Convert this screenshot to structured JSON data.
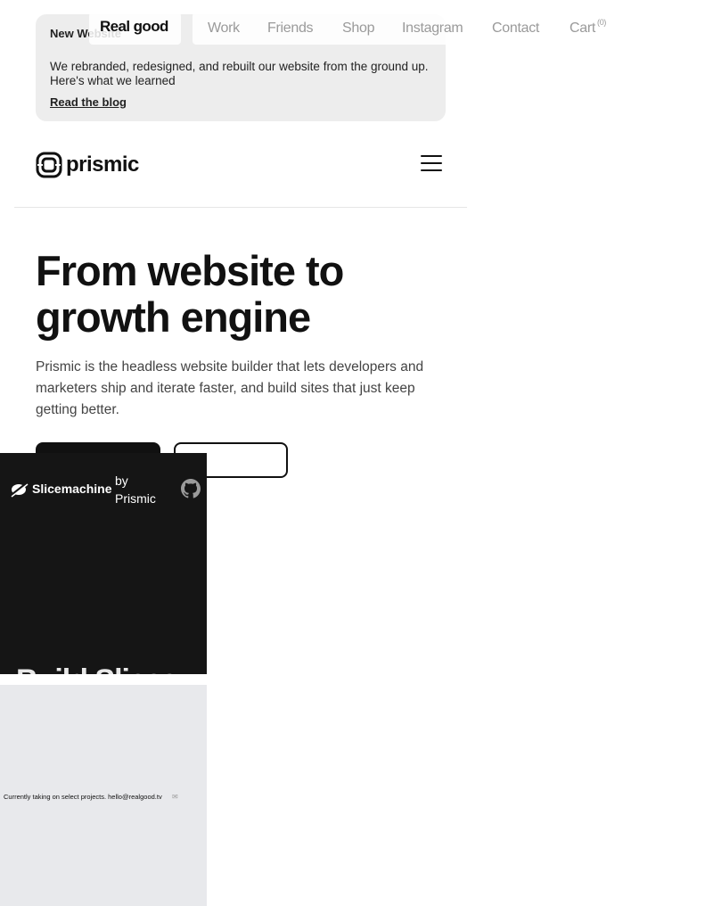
{
  "banner": {
    "title": "New Website",
    "text": "We rebranded, redesigned, and rebuilt our website from the ground up. Here's what we learned",
    "link": "Read the blog"
  },
  "prismic_nav": {
    "logo_text": "prismic"
  },
  "hero": {
    "title": "From website to growth engine",
    "subtitle": "Prismic is the headless website builder that lets developers and marketers ship and iterate faster, and build sites that just keep getting better."
  },
  "realgood_nav": {
    "brand": "Real good",
    "items": [
      "Work",
      "Friends",
      "Shop",
      "Instagram",
      "Contact"
    ],
    "cart_label": "Cart",
    "cart_count": "(0)"
  },
  "slicemachine": {
    "name": "Slicemachine",
    "by": "by Prismic",
    "headline_partial": "Build Slices"
  },
  "footer_panel": {
    "text": "Currently taking on select projects. hello@realgood.tv",
    "icon": "mail-icon"
  }
}
